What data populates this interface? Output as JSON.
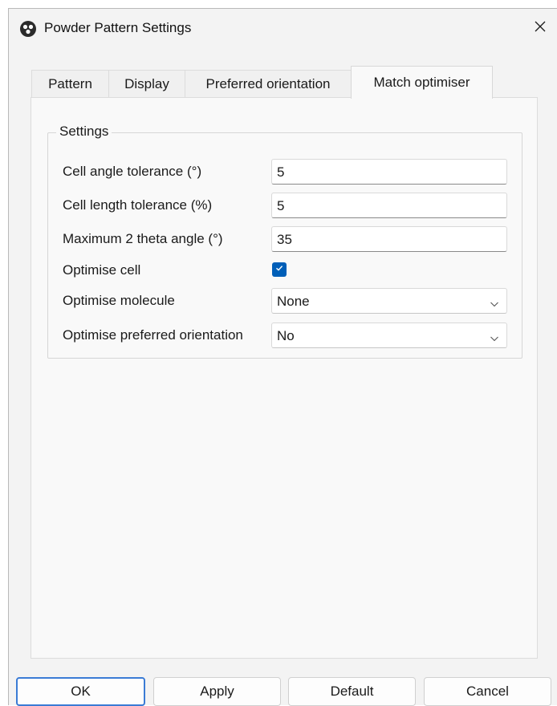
{
  "window": {
    "title": "Powder Pattern Settings",
    "app_icon": "app-logo-icon",
    "close_icon": "close-icon"
  },
  "tabs": [
    {
      "label": "Pattern",
      "active": false
    },
    {
      "label": "Display",
      "active": false
    },
    {
      "label": "Preferred orientation",
      "active": false
    },
    {
      "label": "Match optimiser",
      "active": true
    }
  ],
  "settings": {
    "group_title": "Settings",
    "cell_angle_tolerance": {
      "label": "Cell angle tolerance (°)",
      "value": "5"
    },
    "cell_length_tolerance": {
      "label": "Cell length tolerance (%)",
      "value": "5"
    },
    "max_two_theta": {
      "label": "Maximum 2 theta angle (°)",
      "value": "35"
    },
    "optimise_cell": {
      "label": "Optimise cell",
      "checked": true
    },
    "optimise_molecule": {
      "label": "Optimise molecule",
      "selected": "None"
    },
    "optimise_preferred_orientation": {
      "label": "Optimise preferred orientation",
      "selected": "No"
    }
  },
  "buttons": {
    "ok": "OK",
    "apply": "Apply",
    "default": "Default",
    "cancel": "Cancel"
  },
  "colors": {
    "accent": "#005fb8",
    "window_bg": "#f3f3f3",
    "pane_bg": "#f9f9f9"
  }
}
